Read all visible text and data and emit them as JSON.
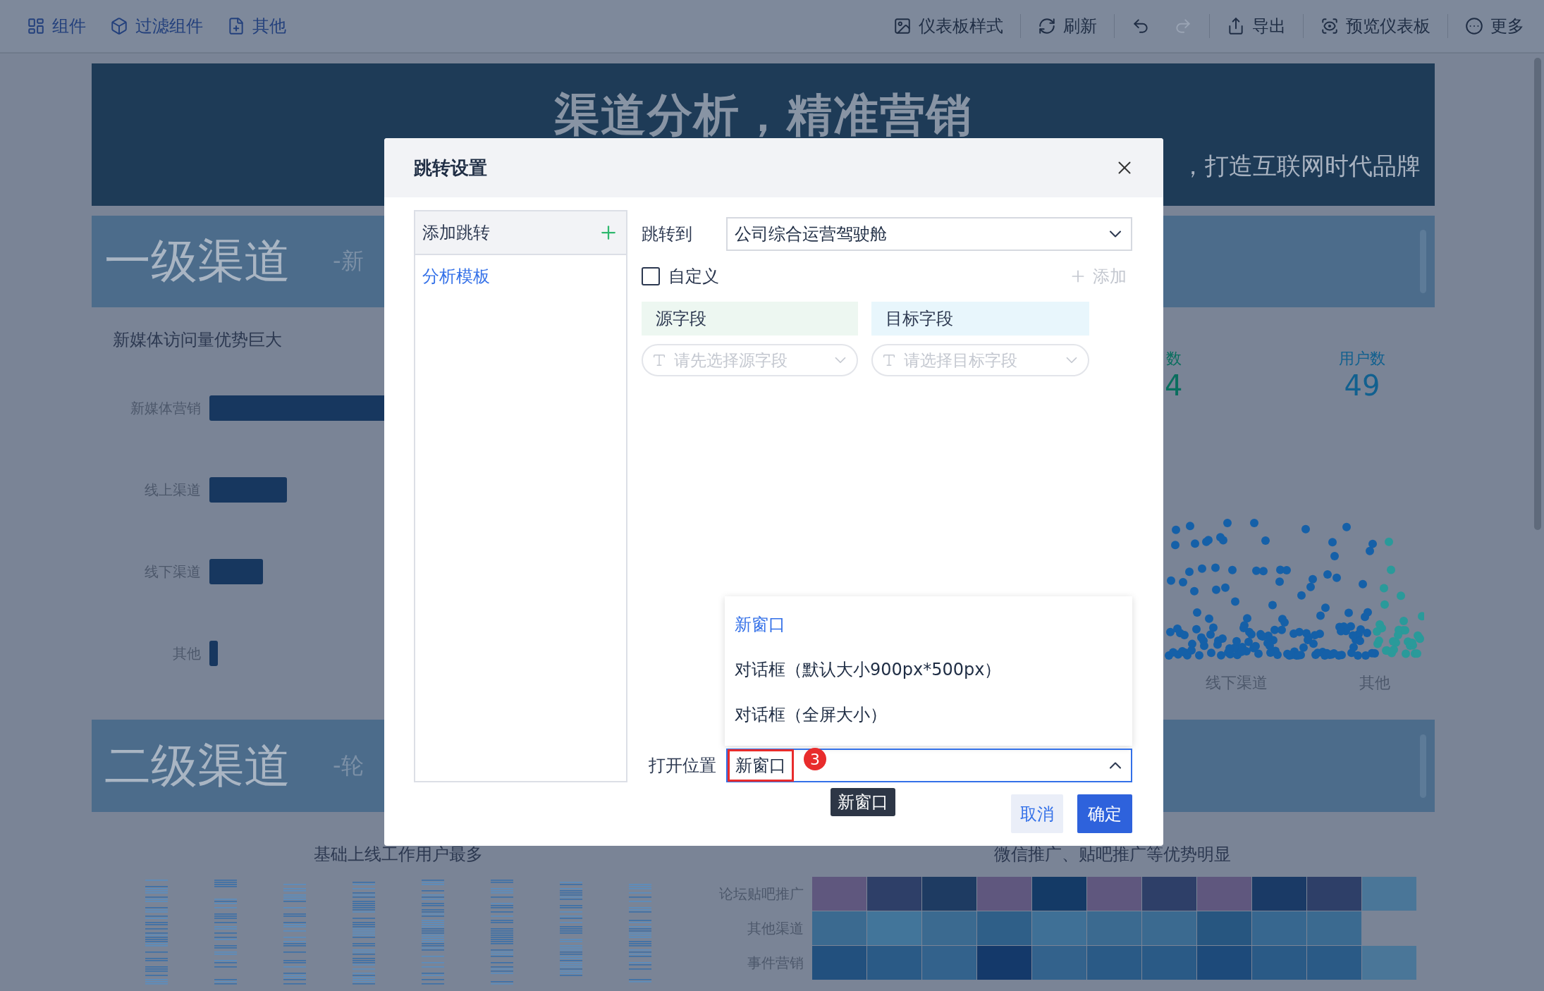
{
  "toolbar": {
    "left": [
      {
        "label": "组件",
        "kind": "widget"
      },
      {
        "label": "过滤组件",
        "kind": "filter"
      },
      {
        "label": "其他",
        "kind": "other"
      }
    ],
    "right": [
      {
        "label": "仪表板样式",
        "kind": "style",
        "disabled": false
      },
      {
        "label": "刷新",
        "kind": "refresh",
        "disabled": false
      },
      {
        "kind": "undo",
        "disabled": false
      },
      {
        "kind": "redo",
        "disabled": true
      },
      {
        "label": "导出",
        "kind": "export",
        "disabled": false
      },
      {
        "label": "预览仪表板",
        "kind": "preview",
        "disabled": false
      },
      {
        "label": "更多",
        "kind": "more",
        "disabled": false
      }
    ]
  },
  "dashboard": {
    "title": "渠道分析，精准营销",
    "subtitle": "，打造互联网时代品牌",
    "sections": [
      {
        "heading": "一级渠道",
        "tagline": "-新"
      },
      {
        "heading": "二级渠道",
        "tagline": "-轮"
      }
    ],
    "bar_chart": {
      "title": "新媒体访问量优势巨大",
      "categories": [
        "新媒体营销",
        "线上渠道",
        "线下渠道",
        "其他"
      ]
    },
    "metrics": [
      {
        "label": "数",
        "value": "4",
        "color": "#0a6e5e"
      },
      {
        "label": "用户数",
        "value": "49",
        "color": "#11608f"
      }
    ],
    "scatter": {
      "categories": [
        "线下渠道",
        "其他"
      ]
    },
    "barcode_chart": {
      "title": "基础上线工作用户最多"
    },
    "heatmap": {
      "title": "微信推广、贴吧推广等优势明显",
      "rows": [
        "论坛贴吧推广",
        "其他渠道",
        "事件营销"
      ]
    }
  },
  "dialog": {
    "title": "跳转设置",
    "jump_list": {
      "header": "添加跳转",
      "items": [
        {
          "label": "分析模板",
          "selected": true
        }
      ]
    },
    "target": {
      "label": "跳转到",
      "value": "公司综合运营驾驶舱"
    },
    "custom": {
      "label": "自定义",
      "checked": false
    },
    "add_action": {
      "label": "添加",
      "disabled": true
    },
    "mapping": {
      "columns": [
        "源字段",
        "目标字段"
      ],
      "placeholders": [
        "请先选择源字段",
        "请选择目标字段"
      ]
    },
    "open_position": {
      "label": "打开位置",
      "value": "新窗口",
      "expanded": true,
      "tooltip": "新窗口",
      "options": [
        {
          "label": "新窗口",
          "selected": true
        },
        {
          "label": "对话框（默认大小900px*500px）",
          "selected": false
        },
        {
          "label": "对话框（全屏大小）",
          "selected": false
        }
      ]
    },
    "annotation": {
      "number": "3"
    },
    "buttons": [
      {
        "label": "取消",
        "kind": "secondary"
      },
      {
        "label": "确定",
        "kind": "primary"
      }
    ]
  }
}
